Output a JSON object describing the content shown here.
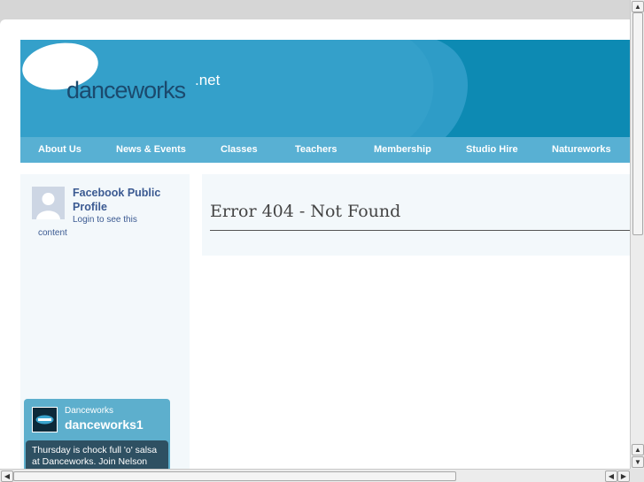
{
  "site": {
    "logo": {
      "text": "danceworks",
      "suffix": ".net"
    },
    "nav": [
      {
        "label": "About Us"
      },
      {
        "label": "News & Events"
      },
      {
        "label": "Classes"
      },
      {
        "label": "Teachers"
      },
      {
        "label": "Membership"
      },
      {
        "label": "Studio Hire"
      },
      {
        "label": "Natureworks"
      }
    ]
  },
  "sidebar": {
    "facebook": {
      "title": "Facebook Public Profile",
      "login": "Login to see this",
      "content": "content"
    },
    "twitter": {
      "name": "Danceworks",
      "handle": "danceworks1",
      "tweet": "Thursday is chock full 'o' salsa at Danceworks. Join Nelson"
    }
  },
  "main": {
    "title": "Error 404 - Not Found"
  },
  "colors": {
    "banner": "#0d8ab3",
    "nav": "#58b0d3",
    "accent_dark": "#1b4a6e",
    "panel": "#f3f8fb"
  },
  "icons": {
    "scroll_up": "scroll-up-arrow-icon",
    "scroll_down": "scroll-down-arrow-icon",
    "scroll_left": "scroll-left-arrow-icon",
    "scroll_right": "scroll-right-arrow-icon"
  }
}
